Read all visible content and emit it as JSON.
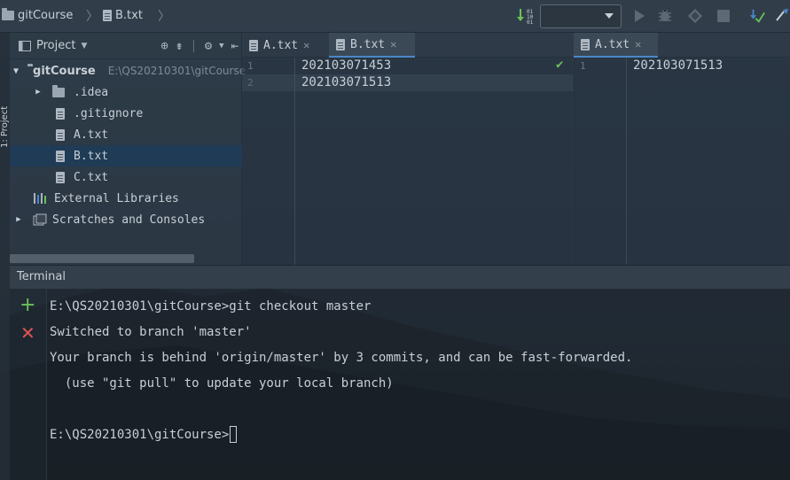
{
  "navbar": {
    "project_name": "gitCourse",
    "file_name": "B.txt",
    "run_config_value": ""
  },
  "project_panel": {
    "title": "Project",
    "side_label": "1: Project",
    "root_name": "gitCourse",
    "root_path": "E:\\QS20210301\\gitCourse",
    "items": [
      {
        "label": ".idea",
        "type": "folder"
      },
      {
        "label": ".gitignore",
        "type": "file"
      },
      {
        "label": "A.txt",
        "type": "file"
      },
      {
        "label": "B.txt",
        "type": "file",
        "selected": true
      },
      {
        "label": "C.txt",
        "type": "file"
      }
    ],
    "external_libraries": "External Libraries",
    "scratches": "Scratches and Consoles"
  },
  "editor_left": {
    "tabs": [
      {
        "label": "A.txt",
        "active": false
      },
      {
        "label": "B.txt",
        "active": true
      }
    ],
    "lines": [
      {
        "num": "1",
        "text": "202103071453"
      },
      {
        "num": "2",
        "text": "202103071513"
      }
    ]
  },
  "editor_right": {
    "tabs": [
      {
        "label": "A.txt",
        "active": true
      }
    ],
    "lines": [
      {
        "num": "1",
        "text": "202103071513"
      }
    ]
  },
  "terminal": {
    "title": "Terminal",
    "lines": [
      "E:\\QS20210301\\gitCourse>git checkout master",
      "Switched to branch 'master'",
      "Your branch is behind 'origin/master' by 3 commits, and can be fast-forwarded.",
      "  (use \"git pull\" to update your local branch)",
      "",
      "E:\\QS20210301\\gitCourse>"
    ]
  },
  "colors": {
    "accent": "#4a88c7",
    "selection": "#1f3b56",
    "add_green": "#6ac259",
    "close_red": "#e05555"
  }
}
